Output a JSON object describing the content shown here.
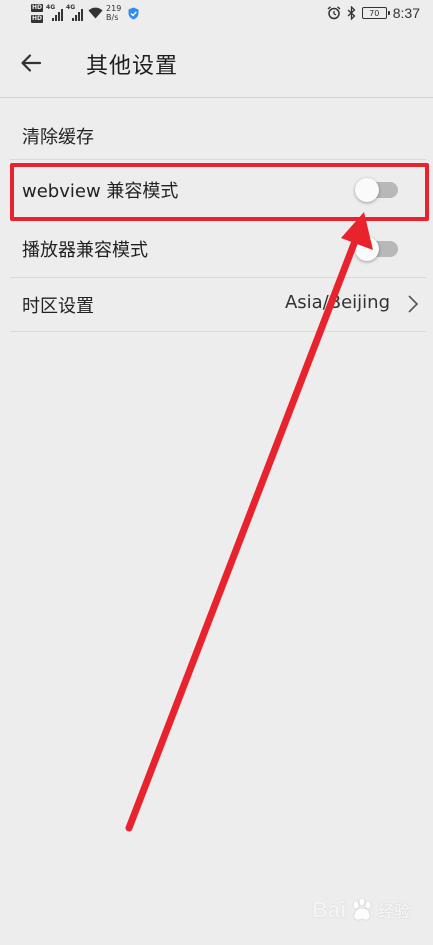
{
  "status_bar": {
    "hd_badges": [
      "HD",
      "HD"
    ],
    "network_tags": [
      "4G",
      "4G"
    ],
    "speed_value": "219",
    "speed_unit": "B/s",
    "battery_level": "70",
    "time": "8:37",
    "icons": [
      "signal-icon",
      "wifi-icon",
      "shield-icon",
      "alarm-icon",
      "bluetooth-icon",
      "battery-icon"
    ]
  },
  "header": {
    "title": "其他设置",
    "back_icon": "arrow-left-icon"
  },
  "settings": {
    "clear_cache": {
      "label": "清除缓存"
    },
    "webview_compat": {
      "label": "webview 兼容模式",
      "enabled": false
    },
    "player_compat": {
      "label": "播放器兼容模式",
      "enabled": false
    },
    "timezone": {
      "label": "时区设置",
      "value": "Asia/Beijing",
      "icon": "chevron-right-icon"
    }
  },
  "annotation": {
    "color": "#e8232e",
    "highlighted_item": "webview_compat"
  },
  "watermark": {
    "text": "Bai",
    "sub": "经验"
  }
}
